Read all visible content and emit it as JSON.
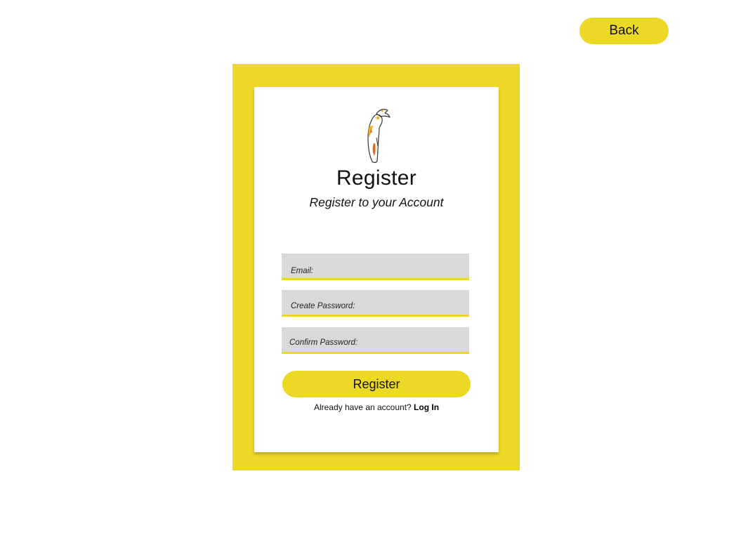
{
  "header": {
    "back_label": "Back"
  },
  "card": {
    "title": "Register",
    "subtitle": "Register to your Account"
  },
  "form": {
    "email_placeholder": "Email:",
    "create_password_placeholder": "Create Password:",
    "confirm_password_placeholder": "Confirm Password:",
    "submit_label": "Register"
  },
  "footer": {
    "prompt_text": "Already have an account?",
    "login_label": "Log In"
  },
  "colors": {
    "accent": "#ecd925",
    "input_bg": "#d9d9d9"
  },
  "icons": {
    "logo": "hornbill-bird-icon"
  }
}
